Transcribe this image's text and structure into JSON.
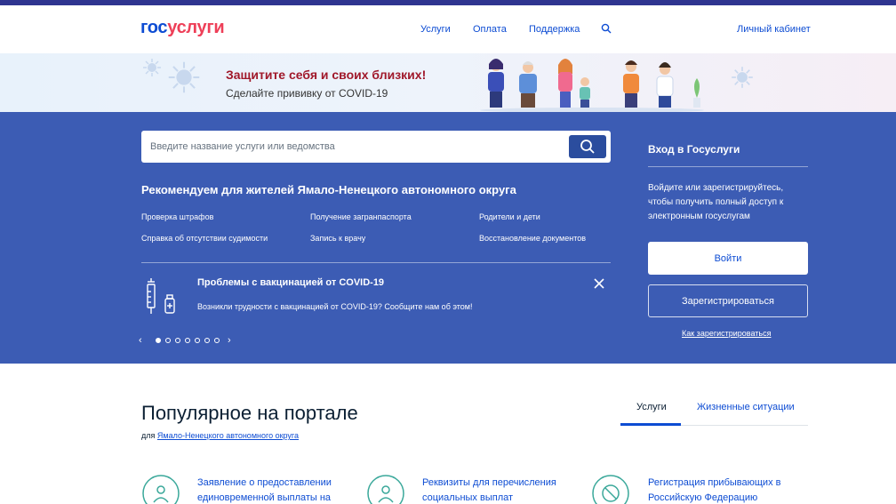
{
  "header": {
    "logo_part1": "гос",
    "logo_part2": "услуги",
    "nav": [
      "Услуги",
      "Оплата",
      "Поддержка"
    ],
    "cabinet": "Личный кабинет"
  },
  "banner": {
    "title": "Защитите себя и своих близких!",
    "subtitle": "Сделайте прививку от COVID-19"
  },
  "search": {
    "placeholder": "Введите название услуги или ведомства"
  },
  "recommend": {
    "title": "Рекомендуем для жителей Ямало-Ненецкого автономного округа",
    "links": [
      "Проверка штрафов",
      "Получение загранпаспорта",
      "Родители и дети",
      "Справка об отсутствии судимости",
      "Запись к врачу",
      "Восстановление документов"
    ]
  },
  "notice": {
    "title": "Проблемы с вакцинацией от COVID-19",
    "text": "Возникли трудности с вакцинацией от COVID-19? Сообщите нам об этом!"
  },
  "carousel": {
    "total": 7,
    "active": 0,
    "prev": "‹",
    "next": "›"
  },
  "login": {
    "title": "Вход в Госуслуги",
    "text": "Войдите или зарегистрируйтесь, чтобы получить полный доступ к электронным госуслугам",
    "login_button": "Войти",
    "register_button": "Зарегистрироваться",
    "how_to": "Как зарегистрироваться"
  },
  "popular": {
    "title": "Популярное на портале",
    "sub_prefix": "для",
    "sub_link": "Ямало-Ненецкого автономного округа",
    "tabs": [
      "Услуги",
      "Жизненные ситуации"
    ],
    "active_tab": 0,
    "cards": [
      "Заявление о предоставлении единовременной выплаты на",
      "Реквизиты для перечисления социальных выплат",
      "Регистрация прибывающих в Российскую Федерацию"
    ]
  },
  "colors": {
    "brand_blue": "#0d4cd3",
    "brand_red": "#ee3f58",
    "hero": "#3c5cb4",
    "top_strip": "#2f3590"
  }
}
